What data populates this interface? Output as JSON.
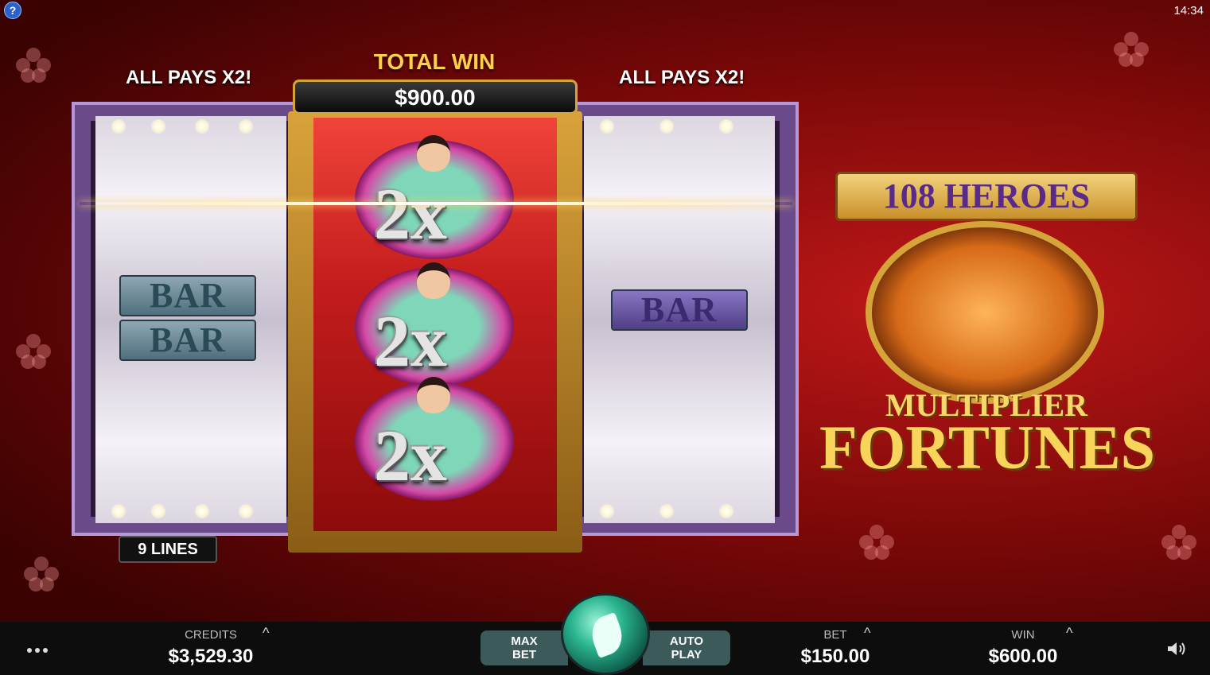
{
  "topbar": {
    "help_symbol": "?",
    "clock": "14:34"
  },
  "reels_header": {
    "left_label": "ALL PAYS X2!",
    "right_label": "ALL PAYS X2!",
    "total_win_label": "TOTAL WIN",
    "total_win_value": "$900.00"
  },
  "reels": {
    "left": {
      "symbols": [
        "BAR",
        "BAR"
      ]
    },
    "center": {
      "symbols": [
        "2x",
        "2x",
        "2x"
      ]
    },
    "right": {
      "symbols": [
        "BAR"
      ]
    }
  },
  "lines_badge": "9 LINES",
  "logo": {
    "banner": "108 HEROES",
    "title_line1": "MULTIPLIER",
    "title_line2": "FORTUNES"
  },
  "bottom_bar": {
    "credits_label": "CREDITS",
    "credits_value": "$3,529.30",
    "max_bet_line1": "MAX",
    "max_bet_line2": "BET",
    "auto_play_line1": "AUTO",
    "auto_play_line2": "PLAY",
    "bet_label": "BET",
    "bet_value": "$150.00",
    "win_label": "WIN",
    "win_value": "$600.00",
    "caret_symbol": "^",
    "menu_icon": "more-dots-icon",
    "sound_icon": "speaker-icon",
    "spin_icon": "spin-leaf-icon"
  },
  "colors": {
    "background": "#7a0808",
    "gold": "#d6a53a",
    "spin_button": "#2bb690"
  }
}
